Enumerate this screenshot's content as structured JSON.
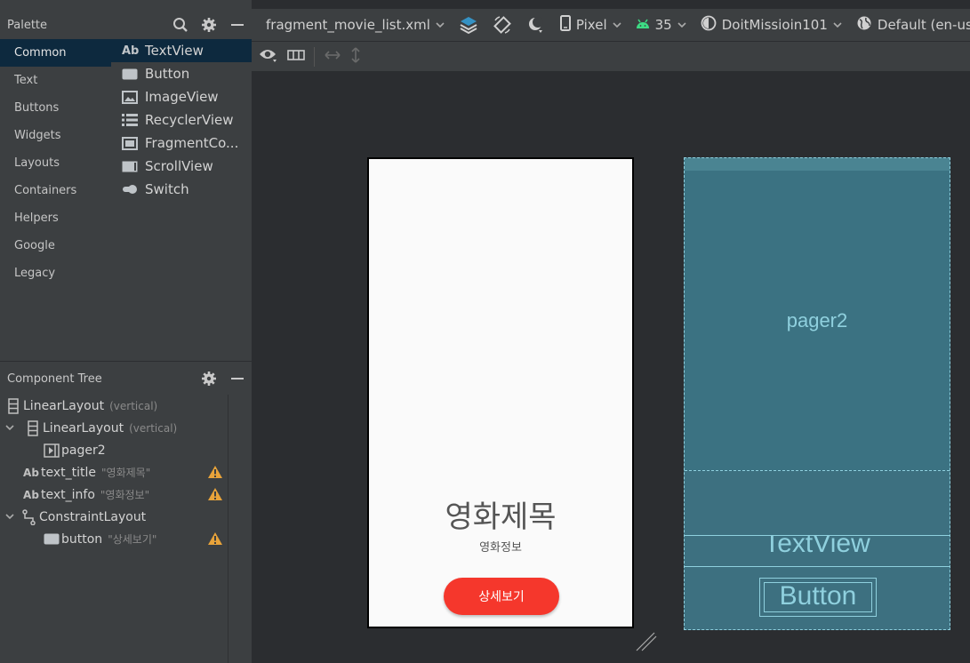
{
  "palette": {
    "title": "Palette",
    "categories": [
      "Common",
      "Text",
      "Buttons",
      "Widgets",
      "Layouts",
      "Containers",
      "Helpers",
      "Google",
      "Legacy"
    ],
    "items": [
      {
        "icon": "textview-icon",
        "label": "TextView"
      },
      {
        "icon": "button-widget-icon",
        "label": "Button"
      },
      {
        "icon": "imageview-icon",
        "label": "ImageView"
      },
      {
        "icon": "recyclerview-icon",
        "label": "RecyclerView"
      },
      {
        "icon": "fragment-container-icon",
        "label": "FragmentCo..."
      },
      {
        "icon": "scrollview-icon",
        "label": "ScrollView"
      },
      {
        "icon": "switch-icon",
        "label": "Switch"
      }
    ]
  },
  "component_tree": {
    "title": "Component Tree",
    "rows": [
      {
        "label": "LinearLayout",
        "sub": "(vertical)"
      },
      {
        "label": "LinearLayout",
        "sub": "(vertical)"
      },
      {
        "label": "pager2",
        "sub": ""
      },
      {
        "label": "text_title",
        "sub": "\"영화제목\""
      },
      {
        "label": "text_info",
        "sub": "\"영화정보\""
      },
      {
        "label": "ConstraintLayout",
        "sub": ""
      },
      {
        "label": "button",
        "sub": "\"상세보기\""
      }
    ],
    "warning_color": "#e8a33a"
  },
  "toolbar": {
    "file": "fragment_movie_list.xml",
    "device": "Pixel",
    "api": "35",
    "theme": "DoitMissioin101",
    "locale": "Default (en-us"
  },
  "design": {
    "title": "영화제목",
    "info": "영화정보",
    "button": "상세보기",
    "button_color": "#f5372c"
  },
  "blueprint": {
    "pager": "pager2",
    "textview": "TextView",
    "button": "Button",
    "accent_color": "#8fd0de"
  }
}
